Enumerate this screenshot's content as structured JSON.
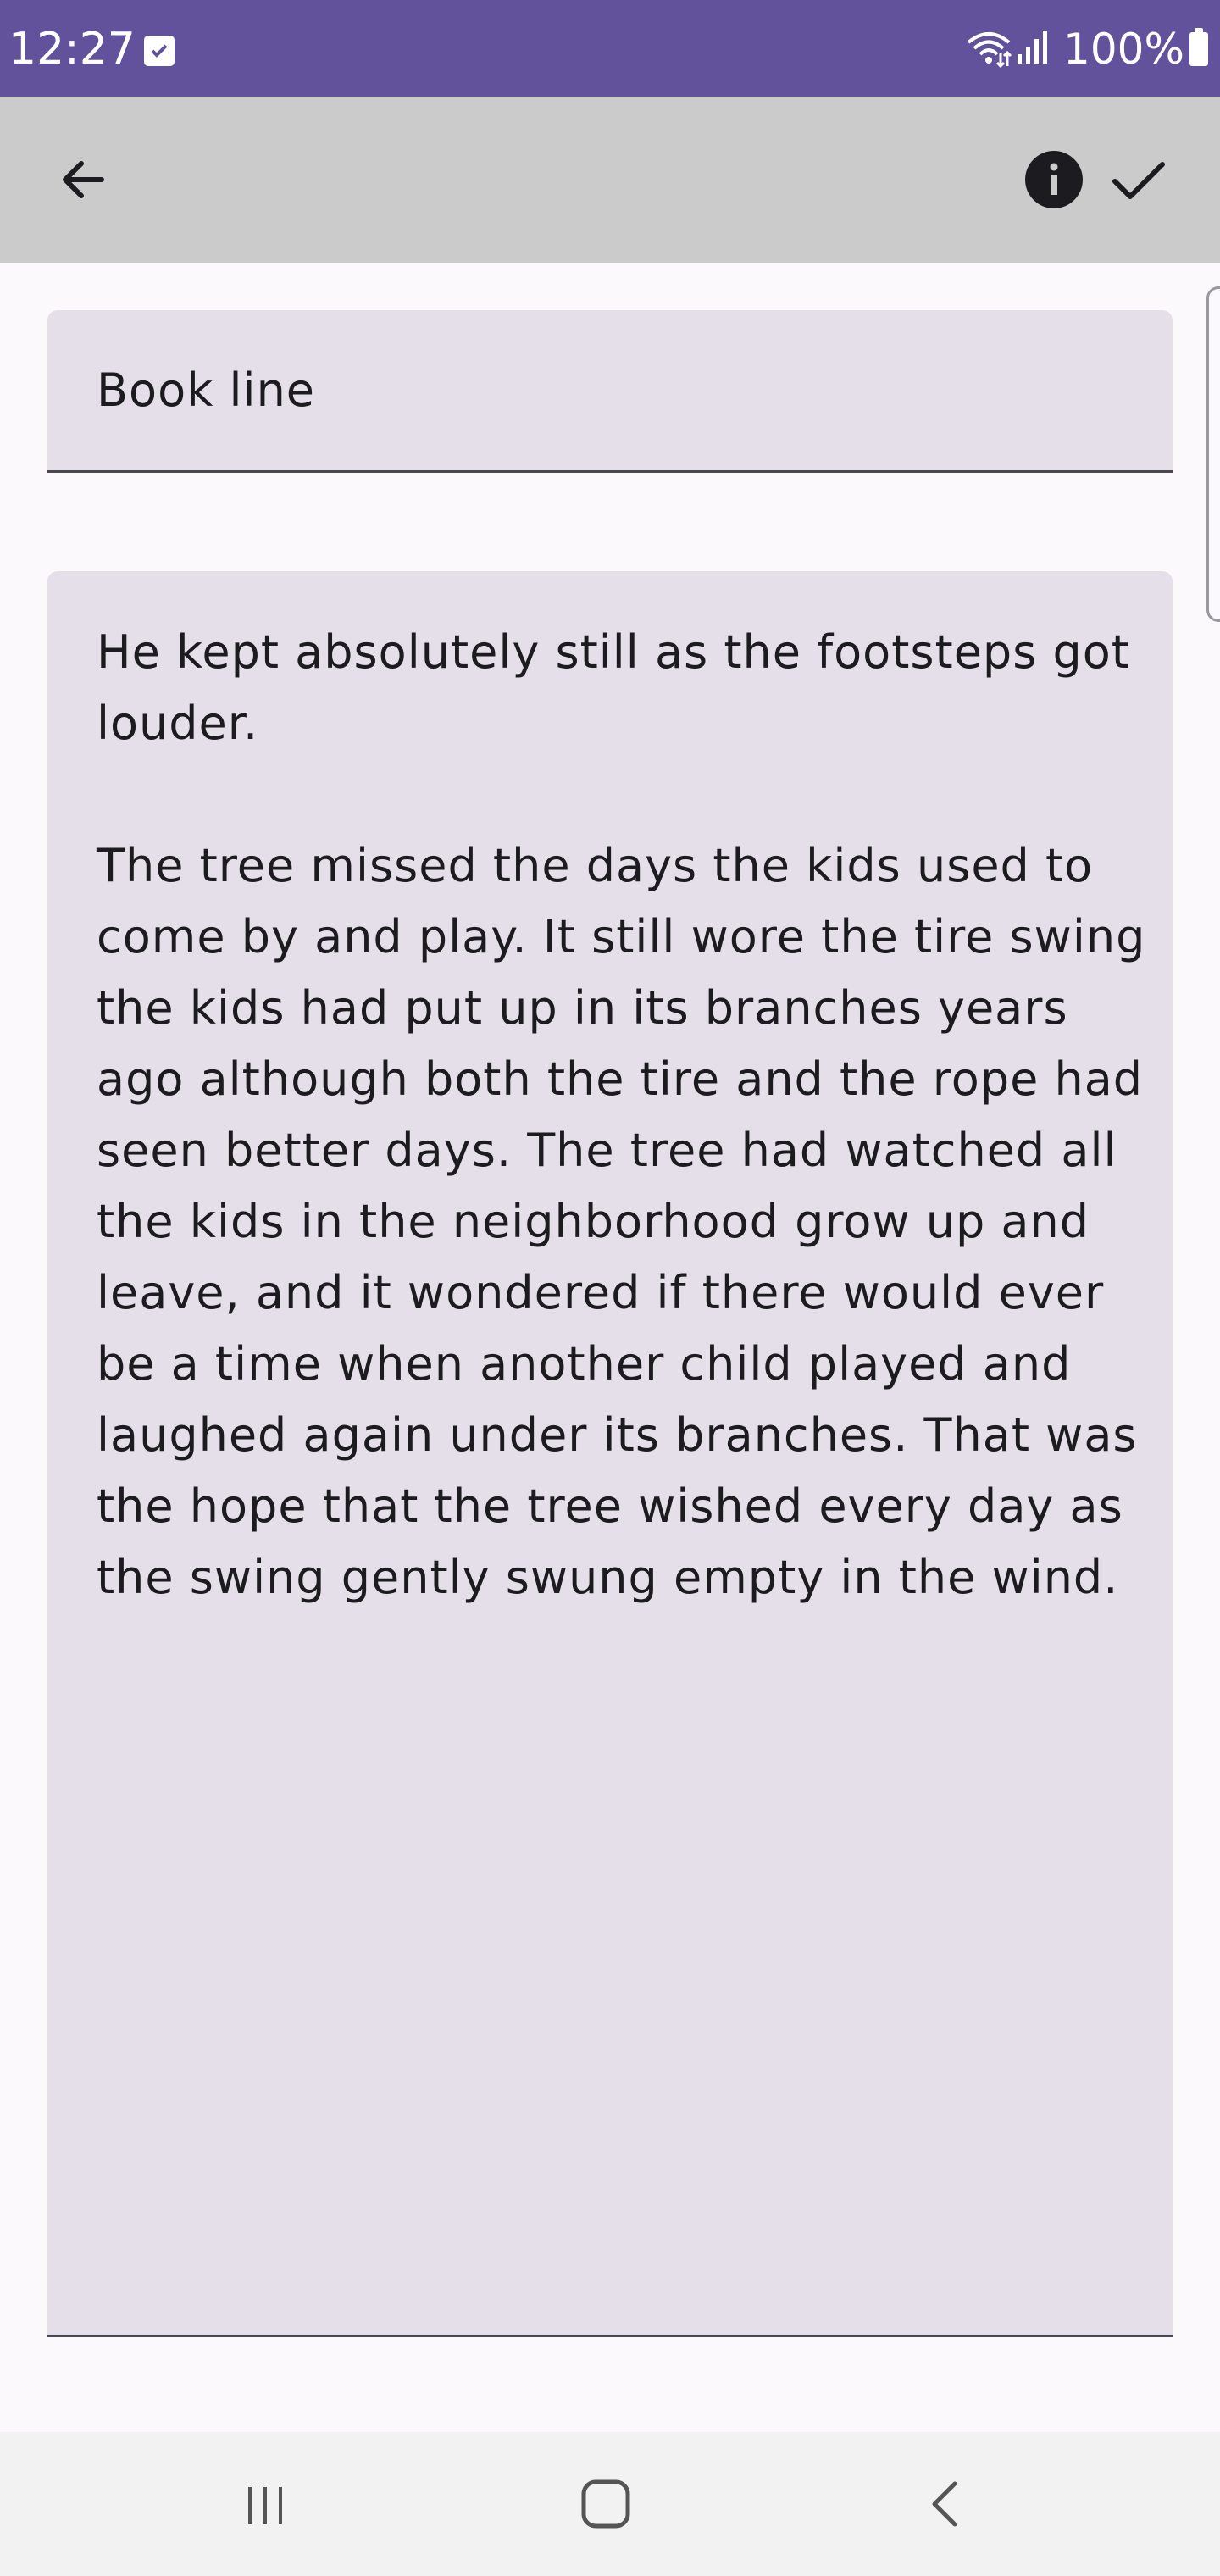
{
  "status_bar": {
    "time": "12:27",
    "battery": "100%",
    "notification_icon": "checkbox-notification-icon",
    "wifi_icon": "wifi-icon",
    "signal_icon": "signal-icon",
    "battery_icon": "battery-icon"
  },
  "app_bar": {
    "back_icon": "arrow-back-icon",
    "info_icon": "info-icon",
    "done_icon": "check-icon"
  },
  "note": {
    "title": "Book line",
    "body": "He kept absolutely still as the footsteps got louder.\n\nThe tree missed the days the kids used to come by and play. It still wore the tire swing the kids had put up in its branches years ago although both the tire and the rope had seen better days. The tree had watched all the kids in the neighborhood grow up and leave, and it wondered if there would ever be a time when another child played and laughed again under its branches. That was the hope that the tree wished every day as the swing gently swung empty in the wind."
  },
  "nav_bar": {
    "recents_icon": "recents-icon",
    "home_icon": "home-icon",
    "back_icon": "nav-back-icon"
  },
  "colors": {
    "status_bar": "#61529b",
    "app_bar": "#cbcbcb",
    "field_background": "#e4dfe8",
    "page_background": "#fcf9fc",
    "text": "#1c1b1f"
  }
}
